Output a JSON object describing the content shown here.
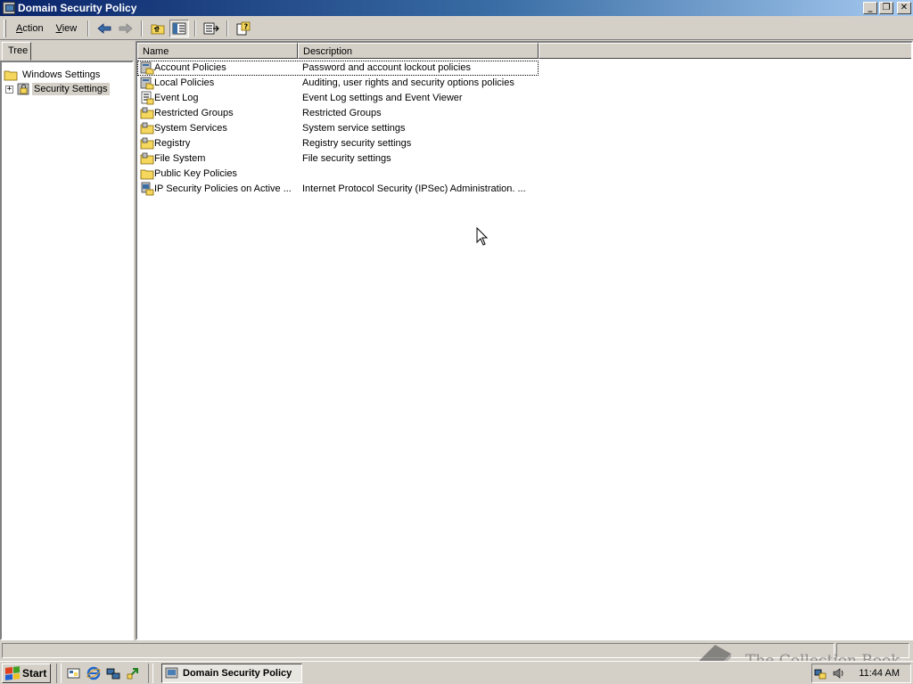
{
  "window": {
    "title": "Domain Security Policy",
    "controls": {
      "minimize": "_",
      "restore": "❐",
      "close": "✕"
    }
  },
  "menu": {
    "action": {
      "accel": "A",
      "rest": "ction"
    },
    "view": {
      "accel": "V",
      "rest": "iew"
    }
  },
  "toolbar": {
    "buttons": [
      "back-arrow-icon",
      "forward-arrow-icon",
      "up-one-level-icon",
      "show-hide-tree-icon",
      "export-list-icon",
      "help-icon"
    ]
  },
  "tree": {
    "tab_label": "Tree",
    "nodes": [
      {
        "label": "Windows Settings",
        "icon": "folder-icon",
        "selected": false
      },
      {
        "label": "Security Settings",
        "icon": "security-settings-icon",
        "expander": "+",
        "selected": true
      }
    ]
  },
  "list": {
    "columns": [
      "Name",
      "Description"
    ],
    "rows": [
      {
        "name": "Account Policies",
        "description": "Password and account lockout policies",
        "icon": "policy-folder-icon"
      },
      {
        "name": "Local Policies",
        "description": "Auditing, user rights and security options policies",
        "icon": "policy-folder-icon"
      },
      {
        "name": "Event Log",
        "description": "Event Log settings and Event Viewer",
        "icon": "event-log-icon"
      },
      {
        "name": "Restricted Groups",
        "description": "Restricted Groups",
        "icon": "locked-folder-icon"
      },
      {
        "name": "System Services",
        "description": "System service settings",
        "icon": "locked-folder-icon"
      },
      {
        "name": "Registry",
        "description": "Registry security settings",
        "icon": "locked-folder-icon"
      },
      {
        "name": "File System",
        "description": "File security settings",
        "icon": "locked-folder-icon"
      },
      {
        "name": "Public Key Policies",
        "description": "",
        "icon": "folder-icon"
      },
      {
        "name": "IP Security Policies on Active ...",
        "description": "Internet Protocol Security (IPSec) Administration. ...",
        "icon": "ip-security-icon"
      }
    ]
  },
  "taskbar": {
    "start_label": "Start",
    "quick_launch": [
      "show-desktop-icon",
      "internet-explorer-icon",
      "network-icon",
      "recycle-icon"
    ],
    "task_button_label": "Domain Security Policy",
    "clock": "11:44 AM"
  },
  "watermark": {
    "text": "The Collection Book"
  },
  "colors": {
    "title_gradient_start": "#0a246a",
    "title_gradient_end": "#a6caf0",
    "chrome": "#d4d0c8",
    "folder_yellow": "#f4d75c"
  }
}
